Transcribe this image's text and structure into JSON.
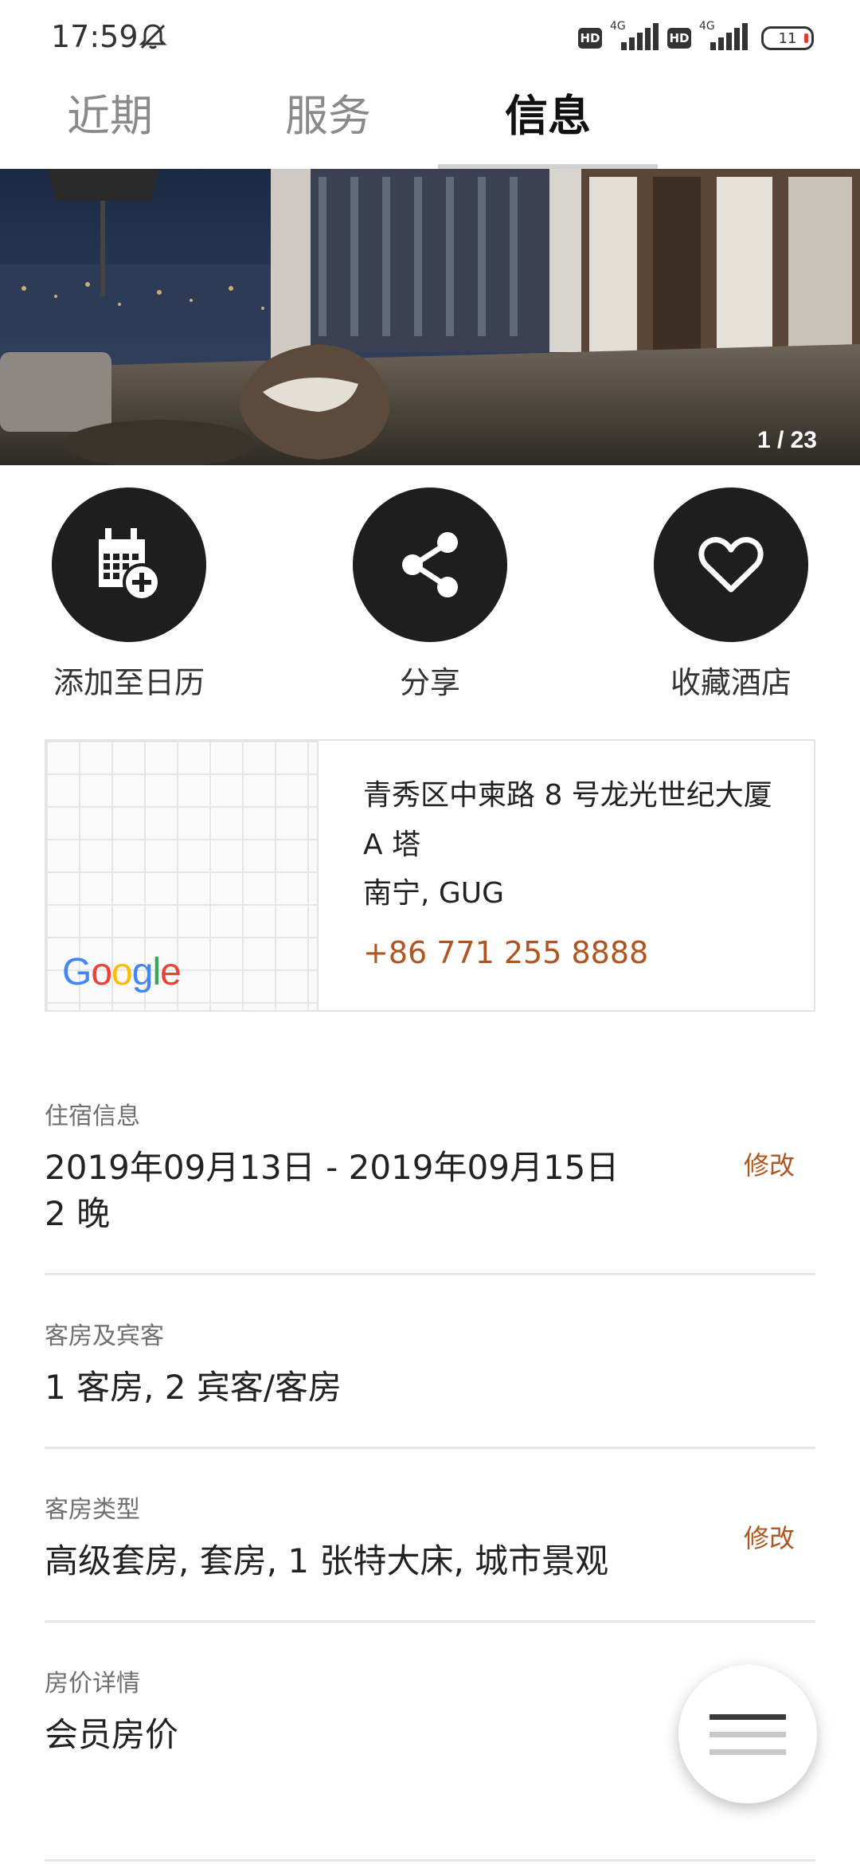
{
  "status_bar": {
    "time": "17:59",
    "hd1": "HD",
    "net1": "4G",
    "hd2": "HD",
    "net2": "4G",
    "battery": "11",
    "icons": [
      "bell-off-icon",
      "signal-icon",
      "battery-icon"
    ]
  },
  "tabs": [
    {
      "label": "近期",
      "active": false
    },
    {
      "label": "服务",
      "active": false
    },
    {
      "label": "信息",
      "active": true
    }
  ],
  "hero": {
    "counter": "1 / 23"
  },
  "actions": [
    {
      "label": "添加至日历",
      "icon": "calendar-add-icon"
    },
    {
      "label": "分享",
      "icon": "share-icon"
    },
    {
      "label": "收藏酒店",
      "icon": "heart-icon"
    }
  ],
  "hotel": {
    "address": "青秀区中柬路 8 号龙光世纪大厦 A 塔",
    "city": "南宁, GUG",
    "phone": "+86 771 255 8888",
    "map_logo": "Google"
  },
  "sections": {
    "stay": {
      "label": "住宿信息",
      "dates": "2019年09月13日 - 2019年09月15日",
      "nights": "2 晚",
      "modify": "修改"
    },
    "rooms": {
      "label": "客房及宾客",
      "value": "1 客房, 2 宾客/客房"
    },
    "room_type": {
      "label": "客房类型",
      "value": "高级套房, 套房, 1  张特大床, 城市景观",
      "modify": "修改"
    },
    "rate": {
      "label": "房价详情",
      "value": "会员房价"
    }
  },
  "colors": {
    "accent": "#b0551f",
    "action_bg": "#1e1e1e",
    "divider": "#e6e6e6"
  }
}
